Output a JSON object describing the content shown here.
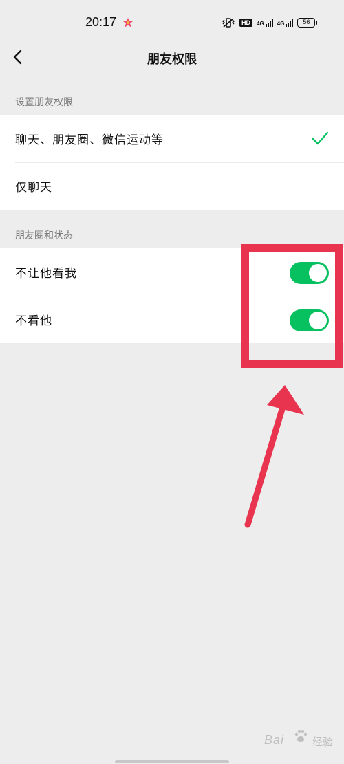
{
  "status_bar": {
    "time": "20:17",
    "hd_label": "HD",
    "net_label_1": "4G",
    "net_label_2": "4G",
    "battery": "56"
  },
  "nav": {
    "title": "朋友权限"
  },
  "section1": {
    "header": "设置朋友权限",
    "items": [
      {
        "label": "聊天、朋友圈、微信运动等",
        "selected": true
      },
      {
        "label": "仅聊天",
        "selected": false
      }
    ]
  },
  "section2": {
    "header": "朋友圈和状态",
    "items": [
      {
        "label": "不让他看我",
        "on": true
      },
      {
        "label": "不看他",
        "on": true
      }
    ]
  },
  "watermark": {
    "text": "Bai",
    "suffix": "经验"
  },
  "colors": {
    "accent_green": "#07c160",
    "annotation_red": "#e8344e",
    "background": "#ededed"
  }
}
